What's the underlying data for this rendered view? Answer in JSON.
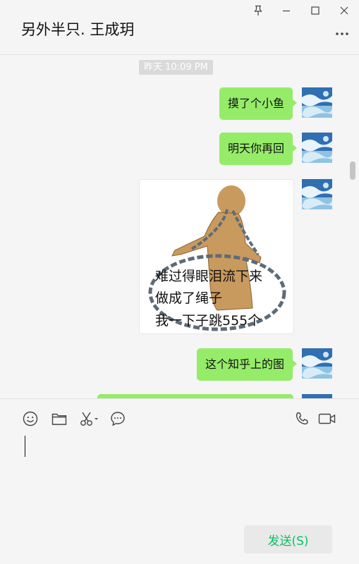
{
  "window": {
    "title": "另外半只. 王成玥",
    "controls": [
      "pin-icon",
      "minimize-icon",
      "maximize-icon",
      "close-icon"
    ],
    "more_icon": "more-icon"
  },
  "chat": {
    "timestamp": "昨天 10:09 PM",
    "messages": [
      {
        "type": "text",
        "sender": "me",
        "text": "摸了个小鱼"
      },
      {
        "type": "text",
        "sender": "me",
        "text": "明天你再回"
      },
      {
        "type": "sticker",
        "sender": "me",
        "lines": [
          "难过得眼泪流下来",
          "做成了绳子",
          "我一下子跳555个"
        ]
      },
      {
        "type": "text",
        "sender": "me",
        "text": "这个知乎上的图"
      }
    ]
  },
  "toolbar": {
    "left_icons": [
      "emoji-icon",
      "folder-icon",
      "scissors-icon",
      "chat-bubble-icon"
    ],
    "right_icons": [
      "phone-icon",
      "video-icon"
    ]
  },
  "input": {
    "value": ""
  },
  "send_button": {
    "label": "发送(S)"
  },
  "colors": {
    "bubble_me": "#95ec69",
    "background": "#f5f5f5",
    "send_text": "#07c160",
    "send_bg": "#e9e9e9"
  }
}
